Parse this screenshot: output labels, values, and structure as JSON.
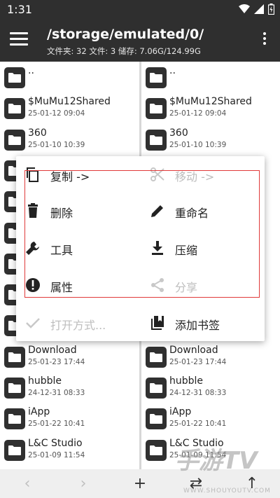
{
  "status": {
    "time": "1:31"
  },
  "header": {
    "path": "/storage/emulated/0/",
    "info": "文件夹: 32  文件: 3  储存: 7.06G/124.99G"
  },
  "left_pane": [
    {
      "name": "..",
      "date": ""
    },
    {
      "name": "$MuMu12Shared",
      "date": "25-01-12 09:04"
    },
    {
      "name": "360",
      "date": "25-01-10 10:39"
    },
    {
      "name": "",
      "date": ""
    },
    {
      "name": "",
      "date": ""
    },
    {
      "name": "",
      "date": ""
    },
    {
      "name": "",
      "date": ""
    },
    {
      "name": "",
      "date": ""
    },
    {
      "name": "",
      "date": ""
    },
    {
      "name": "Download",
      "date": "25-01-23 17:44"
    },
    {
      "name": "hubble",
      "date": "24-12-31 08:33"
    },
    {
      "name": "iApp",
      "date": "25-01-22 10:41"
    },
    {
      "name": "L&C Studio",
      "date": "25-01-09 11:54"
    }
  ],
  "right_pane": [
    {
      "name": "..",
      "date": ""
    },
    {
      "name": "$MuMu12Shared",
      "date": "25-01-12 09:04"
    },
    {
      "name": "360",
      "date": "25-01-10 10:39"
    },
    {
      "name": "",
      "date": ""
    },
    {
      "name": "",
      "date": ""
    },
    {
      "name": "",
      "date": ""
    },
    {
      "name": "",
      "date": ""
    },
    {
      "name": "",
      "date": ""
    },
    {
      "name": "",
      "date": ""
    },
    {
      "name": "Download",
      "date": "25-01-23 17:44"
    },
    {
      "name": "hubble",
      "date": "24-12-31 08:33"
    },
    {
      "name": "iApp",
      "date": "25-01-22 10:41"
    },
    {
      "name": "L&C Studio",
      "date": "25-01-09 11:54"
    }
  ],
  "menu": {
    "copy": "复制 ->",
    "move": "移动 ->",
    "delete": "删除",
    "rename": "重命名",
    "tools": "工具",
    "compress": "压缩",
    "properties": "属性",
    "share": "分享",
    "open_with": "打开方式...",
    "add_bookmark": "添加书签"
  },
  "watermark": {
    "logo": "手游TV",
    "url": "WWW.SHOUYOUTV.COM"
  },
  "colors": {
    "bar": "#2f2f2f",
    "highlight": "#e03a3a",
    "disabled": "#bdbdbd"
  }
}
